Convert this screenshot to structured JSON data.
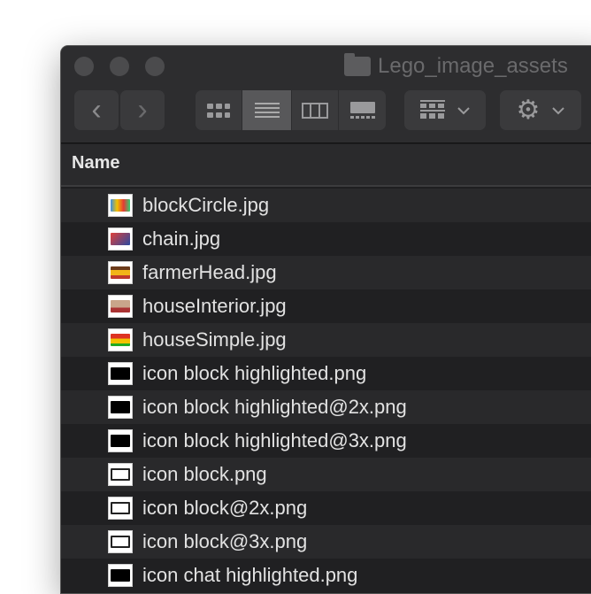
{
  "window": {
    "title": "Lego_image_assets"
  },
  "toolbar": {
    "back": "‹",
    "forward": "›",
    "gear": "⚙",
    "chevron": "⌄"
  },
  "list": {
    "column_header": "Name",
    "files": [
      {
        "name": "blockCircle.jpg",
        "thumb": "multi"
      },
      {
        "name": "chain.jpg",
        "thumb": "chain"
      },
      {
        "name": "farmerHead.jpg",
        "thumb": "face"
      },
      {
        "name": "houseInterior.jpg",
        "thumb": "interior"
      },
      {
        "name": "houseSimple.jpg",
        "thumb": "house"
      },
      {
        "name": "icon block highlighted.png",
        "thumb": "black"
      },
      {
        "name": "icon block highlighted@2x.png",
        "thumb": "black"
      },
      {
        "name": "icon block highlighted@3x.png",
        "thumb": "black"
      },
      {
        "name": "icon block.png",
        "thumb": "outline"
      },
      {
        "name": "icon block@2x.png",
        "thumb": "outline"
      },
      {
        "name": "icon block@3x.png",
        "thumb": "outline"
      },
      {
        "name": "icon chat highlighted.png",
        "thumb": "black"
      }
    ]
  }
}
